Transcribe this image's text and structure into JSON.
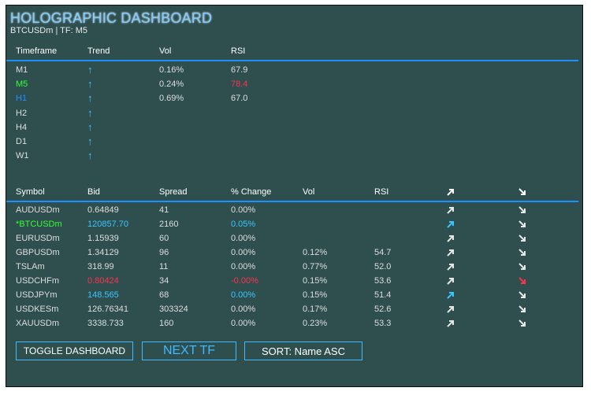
{
  "header": {
    "title": "HOLOGRAPHIC DASHBOARD",
    "subtitle": "BTCUSDm | TF: M5"
  },
  "tf_table": {
    "columns": [
      "Timeframe",
      "Trend",
      "Vol",
      "RSI"
    ],
    "rows": [
      {
        "tf": "M1",
        "tf_color": "#dddddd",
        "vol": "0.16%",
        "rsi": "67.9",
        "rsi_color": "#dddddd",
        "trend_icon": "up-arrow-icon"
      },
      {
        "tf": "M5",
        "tf_color": "#33ff33",
        "vol": "0.24%",
        "rsi": "78.4",
        "rsi_color": "#ff3050",
        "trend_icon": "up-arrow-icon"
      },
      {
        "tf": "H1",
        "tf_color": "#1e90ff",
        "vol": "0.69%",
        "rsi": "67.0",
        "rsi_color": "#dddddd",
        "trend_icon": "up-arrow-icon"
      },
      {
        "tf": "H2",
        "tf_color": "#dddddd",
        "vol": "",
        "rsi": "",
        "rsi_color": "#dddddd",
        "trend_icon": "up-arrow-icon"
      },
      {
        "tf": "H4",
        "tf_color": "#dddddd",
        "vol": "",
        "rsi": "",
        "rsi_color": "#dddddd",
        "trend_icon": "up-arrow-icon"
      },
      {
        "tf": "D1",
        "tf_color": "#dddddd",
        "vol": "",
        "rsi": "",
        "rsi_color": "#dddddd",
        "trend_icon": "up-arrow-icon"
      },
      {
        "tf": "W1",
        "tf_color": "#dddddd",
        "vol": "",
        "rsi": "",
        "rsi_color": "#dddddd",
        "trend_icon": "up-arrow-icon"
      }
    ]
  },
  "symbol_table": {
    "columns": [
      "Symbol",
      "Bid",
      "Spread",
      "% Change",
      "Vol",
      "RSI"
    ],
    "header_icons": [
      "up-right-arrow-icon",
      "down-right-arrow-icon"
    ],
    "rows": [
      {
        "symbol": "AUDUSDm",
        "bid": "0.64849",
        "spread": "41",
        "change": "0.00%",
        "vol": "",
        "rsi": "",
        "sym_color": "#dddddd",
        "bid_color": "#dddddd",
        "change_color": "#dddddd",
        "up_color": "#e6e6e6",
        "down_color": "#e6e6e6"
      },
      {
        "symbol": "*BTCUSDm",
        "bid": "120857.70",
        "spread": "2160",
        "change": "0.05%",
        "vol": "",
        "rsi": "",
        "sym_color": "#33ff33",
        "bid_color": "#39c5ff",
        "change_color": "#39c5ff",
        "up_color": "#39c5ff",
        "down_color": "#e6e6e6"
      },
      {
        "symbol": "EURUSDm",
        "bid": "1.15939",
        "spread": "60",
        "change": "0.00%",
        "vol": "",
        "rsi": "",
        "sym_color": "#dddddd",
        "bid_color": "#dddddd",
        "change_color": "#dddddd",
        "up_color": "#e6e6e6",
        "down_color": "#e6e6e6"
      },
      {
        "symbol": "GBPUSDm",
        "bid": "1.34129",
        "spread": "96",
        "change": "0.00%",
        "vol": "0.12%",
        "rsi": "54.7",
        "sym_color": "#dddddd",
        "bid_color": "#dddddd",
        "change_color": "#dddddd",
        "up_color": "#e6e6e6",
        "down_color": "#e6e6e6"
      },
      {
        "symbol": "TSLAm",
        "bid": "318.99",
        "spread": "11",
        "change": "0.00%",
        "vol": "0.77%",
        "rsi": "52.0",
        "sym_color": "#dddddd",
        "bid_color": "#dddddd",
        "change_color": "#dddddd",
        "up_color": "#e6e6e6",
        "down_color": "#e6e6e6"
      },
      {
        "symbol": "USDCHFm",
        "bid": "0.80424",
        "spread": "34",
        "change": "-0.00%",
        "vol": "0.15%",
        "rsi": "53.6",
        "sym_color": "#dddddd",
        "bid_color": "#ff3050",
        "change_color": "#ff3050",
        "up_color": "#e6e6e6",
        "down_color": "#ff3050"
      },
      {
        "symbol": "USDJPYm",
        "bid": "148.565",
        "spread": "68",
        "change": "0.00%",
        "vol": "0.15%",
        "rsi": "51.4",
        "sym_color": "#dddddd",
        "bid_color": "#39c5ff",
        "change_color": "#39c5ff",
        "up_color": "#39c5ff",
        "down_color": "#e6e6e6"
      },
      {
        "symbol": "USDKESm",
        "bid": "126.76341",
        "spread": "303324",
        "change": "0.00%",
        "vol": "0.17%",
        "rsi": "52.6",
        "sym_color": "#dddddd",
        "bid_color": "#dddddd",
        "change_color": "#dddddd",
        "up_color": "#e6e6e6",
        "down_color": "#e6e6e6"
      },
      {
        "symbol": "XAUUSDm",
        "bid": "3338.733",
        "spread": "160",
        "change": "0.00%",
        "vol": "0.23%",
        "rsi": "53.3",
        "sym_color": "#dddddd",
        "bid_color": "#dddddd",
        "change_color": "#dddddd",
        "up_color": "#e6e6e6",
        "down_color": "#e6e6e6"
      }
    ]
  },
  "buttons": {
    "toggle": "TOGGLE DASHBOARD",
    "next_tf": "NEXT TF",
    "sort": "SORT: Name ASC"
  },
  "colors": {
    "panel": "#2f4f4f",
    "accent": "#1e90ff",
    "title": "#7fcdff",
    "up": "#39c5ff",
    "down": "#ff3050",
    "current": "#33ff33"
  }
}
